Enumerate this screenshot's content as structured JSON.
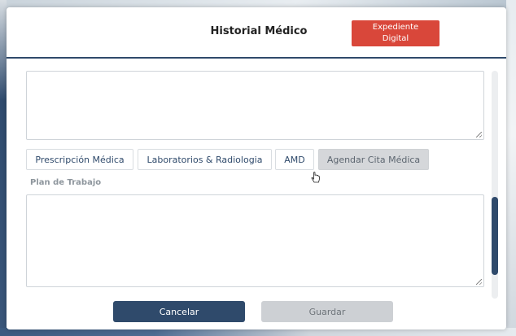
{
  "modal": {
    "title": "Historial Médico",
    "expediente_button": "Expediente\nDigital"
  },
  "tabs": [
    {
      "label": "Prescripción Médica",
      "state": "active"
    },
    {
      "label": "Laboratorios & Radiologia",
      "state": "active"
    },
    {
      "label": "AMD",
      "state": "active"
    },
    {
      "label": "Agendar Cita Médica",
      "state": "disabled"
    }
  ],
  "plan_section": {
    "label": "Plan de Trabajo",
    "value": ""
  },
  "top_textarea": {
    "value": ""
  },
  "footer": {
    "cancel_label": "Cancelar",
    "save_label": "Guardar"
  },
  "colors": {
    "primary": "#2f4a6b",
    "danger": "#d9473a",
    "disabled": "#cdd0d4"
  },
  "icons": {
    "cursor": "hand-pointer-icon",
    "resize": "resize-grip-icon"
  }
}
